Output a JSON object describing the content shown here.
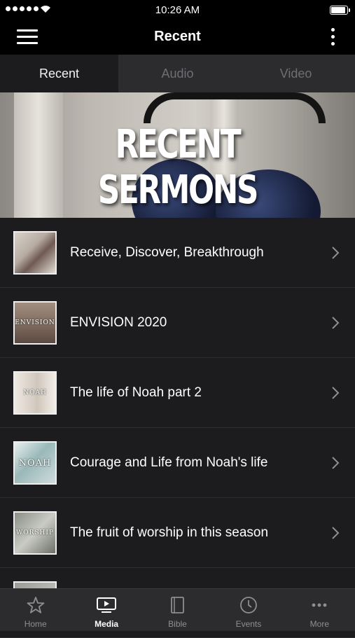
{
  "status_bar": {
    "time": "10:26 AM"
  },
  "nav": {
    "title": "Recent"
  },
  "tabs": [
    {
      "label": "Recent",
      "active": true
    },
    {
      "label": "Audio",
      "active": false
    },
    {
      "label": "Video",
      "active": false
    }
  ],
  "banner": {
    "title": "RECENT SERMONS"
  },
  "sermons": [
    {
      "title": "Receive, Discover, Breakthrough",
      "thumb_text": ""
    },
    {
      "title": "ENVISION 2020",
      "thumb_text": "ENVISION"
    },
    {
      "title": "The life of Noah part 2",
      "thumb_text": "NOAH"
    },
    {
      "title": "Courage and Life from Noah's life",
      "thumb_text": "NOAH"
    },
    {
      "title": "The fruit of worship in this season",
      "thumb_text": "WORSHIP"
    }
  ],
  "tab_bar": [
    {
      "label": "Home",
      "icon": "star-icon",
      "active": false
    },
    {
      "label": "Media",
      "icon": "media-icon",
      "active": true
    },
    {
      "label": "Bible",
      "icon": "book-icon",
      "active": false
    },
    {
      "label": "Events",
      "icon": "clock-icon",
      "active": false
    },
    {
      "label": "More",
      "icon": "more-icon",
      "active": false
    }
  ]
}
